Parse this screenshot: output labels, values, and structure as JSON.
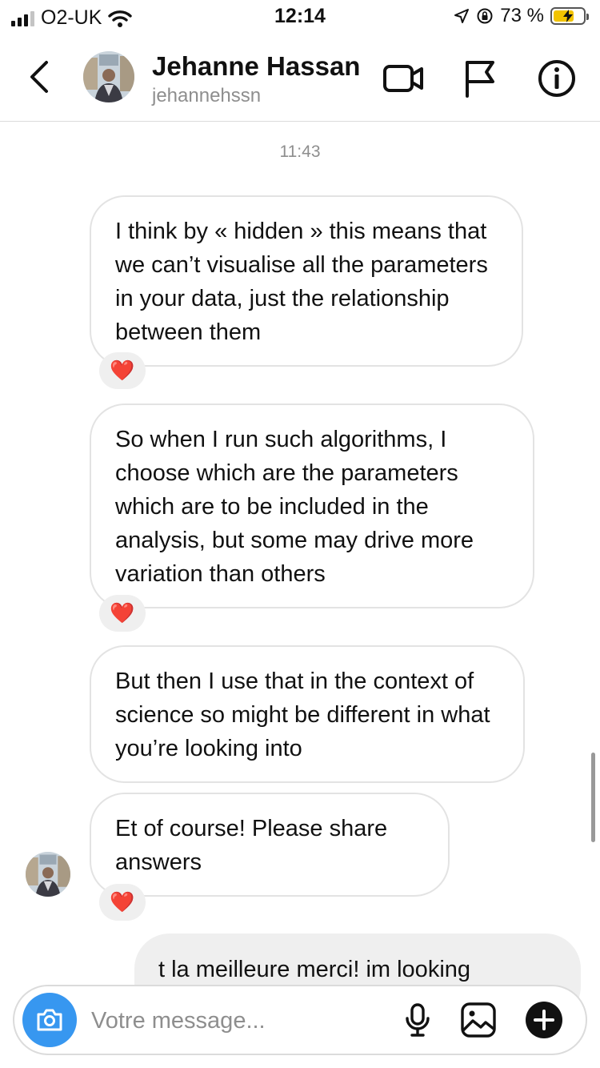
{
  "status_bar": {
    "carrier": "O2-UK",
    "time": "12:14",
    "battery_percent": "73 %",
    "battery_level": 0.73,
    "battery_color": "#f2c300"
  },
  "header": {
    "back_icon": "chevron-left-icon",
    "name": "Jehanne Hassan",
    "username": "jehannehssn",
    "icons": [
      "video-camera-icon",
      "flag-icon",
      "info-icon"
    ]
  },
  "conversation": {
    "timestamp": "11:43",
    "messages": [
      {
        "text": "I think by « hidden » this means that we can’t visualise all the parameters in your data, just the relationship between them",
        "reaction": "❤️"
      },
      {
        "text": "So when I run such algorithms, I choose which are the parameters which are to be included in the analysis, but some may drive more variation than others",
        "reaction": "❤️"
      },
      {
        "text": "But then I use that in the context of science so might be different in what you’re looking into"
      },
      {
        "text": "Et of course! Please share answers",
        "reaction": "❤️"
      }
    ],
    "outgoing": {
      "text": "t la meilleure merci! im looking"
    }
  },
  "composer": {
    "placeholder": "Votre message...",
    "accent_color": "#3797f0",
    "icons": [
      "camera-icon",
      "microphone-icon",
      "image-icon",
      "plus-icon"
    ]
  }
}
